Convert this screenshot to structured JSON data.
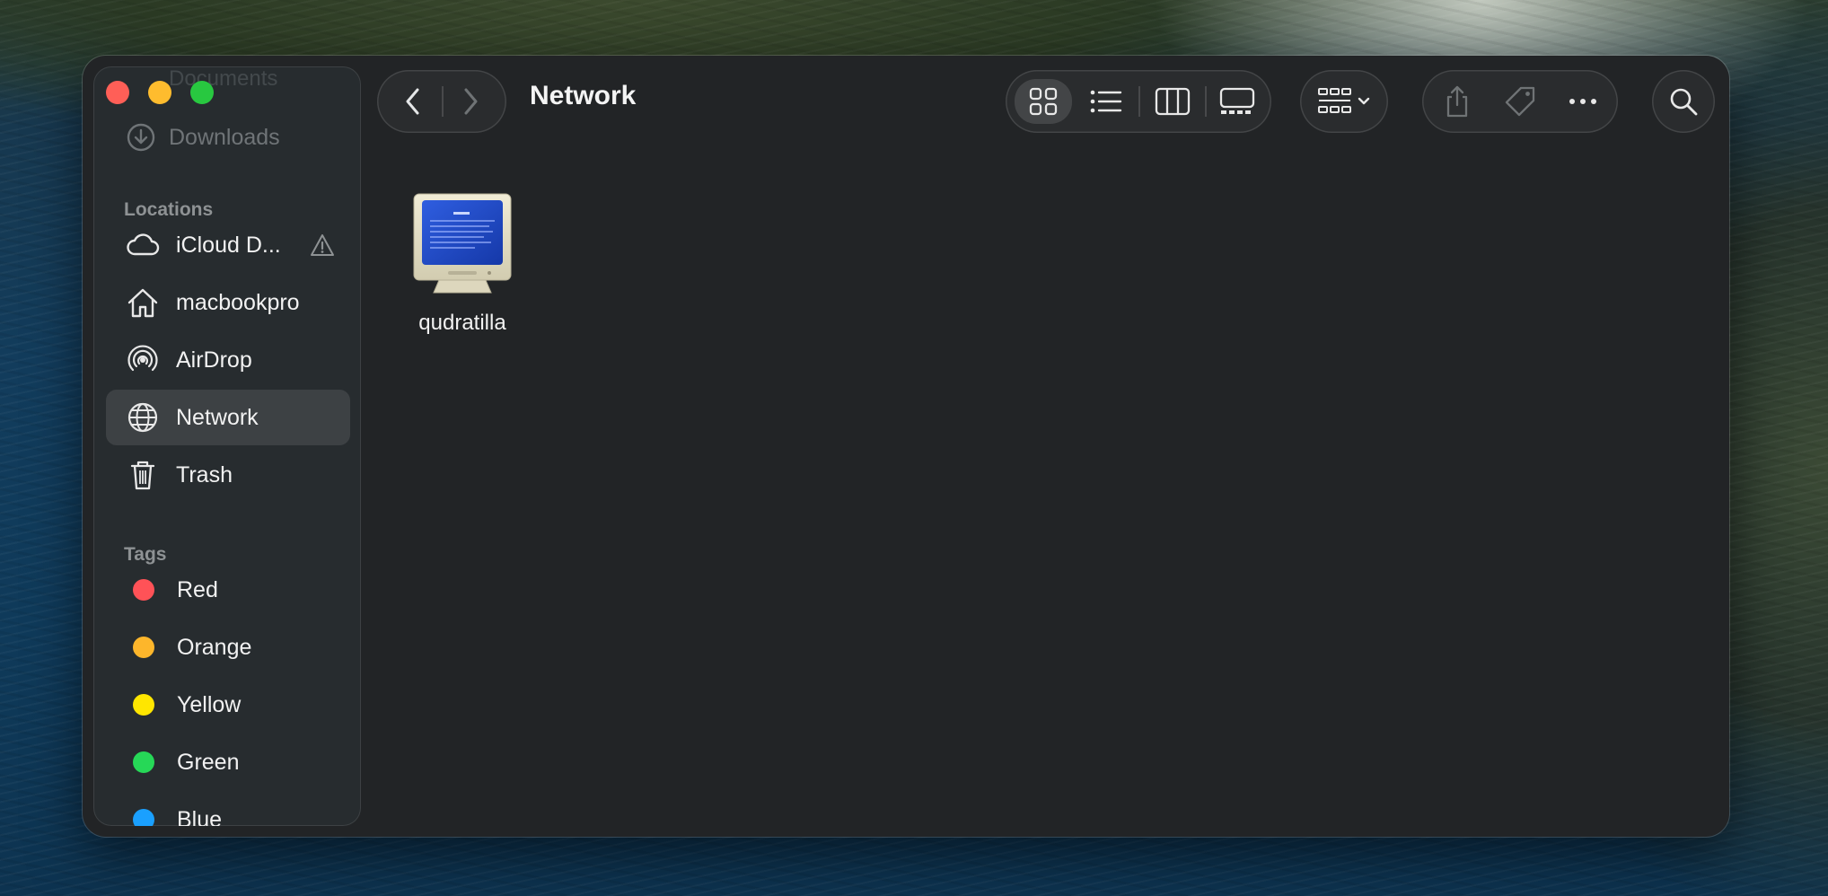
{
  "window": {
    "title": "Network",
    "traffic_lights": [
      "close",
      "minimize",
      "zoom"
    ]
  },
  "sidebar": {
    "faded_top": "Documents",
    "faded_item": "Downloads",
    "locations_title": "Locations",
    "locations": [
      {
        "label": "iCloud D...",
        "icon": "cloud-icon",
        "warning": true
      },
      {
        "label": "macbookpro",
        "icon": "house-icon"
      },
      {
        "label": "AirDrop",
        "icon": "airdrop-icon"
      },
      {
        "label": "Network",
        "icon": "globe-icon",
        "selected": true
      },
      {
        "label": "Trash",
        "icon": "trash-icon"
      }
    ],
    "tags_title": "Tags",
    "tags": [
      {
        "label": "Red",
        "color": "#ff5257"
      },
      {
        "label": "Orange",
        "color": "#fdb62b"
      },
      {
        "label": "Yellow",
        "color": "#ffe600"
      },
      {
        "label": "Green",
        "color": "#26d857"
      },
      {
        "label": "Blue",
        "color": "#1aa0ff"
      }
    ]
  },
  "toolbar": {
    "back": "chevron-left-icon",
    "forward": "chevron-right-icon",
    "views": [
      "icon-view",
      "list-view",
      "column-view",
      "gallery-view"
    ],
    "selected_view": "icon-view",
    "group": "group-icon",
    "share": "share-icon",
    "tag": "tag-icon",
    "more": "ellipsis-icon",
    "search": "search-icon"
  },
  "content": {
    "items": [
      {
        "label": "qudratilla",
        "icon": "monitor-icon"
      }
    ]
  }
}
